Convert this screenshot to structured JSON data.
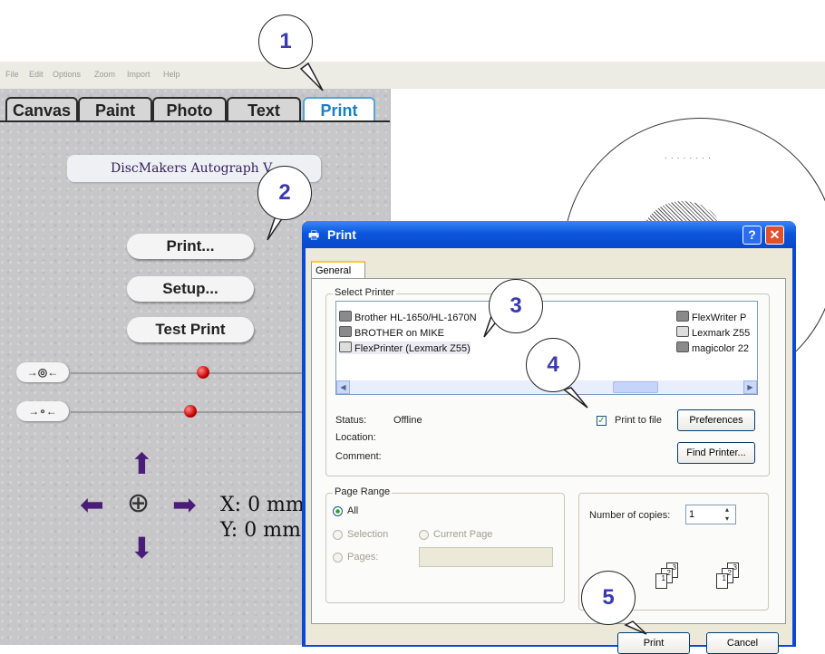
{
  "menu": [
    "File",
    "Edit",
    "Options",
    "Zoom",
    "Import",
    "Help"
  ],
  "tabs": [
    {
      "label": "Canvas",
      "active": false
    },
    {
      "label": "Paint",
      "active": false
    },
    {
      "label": "Photo",
      "active": false
    },
    {
      "label": "Text",
      "active": false
    },
    {
      "label": "Print",
      "active": true
    }
  ],
  "brand": "DiscMakers Autograph V",
  "buttons": {
    "print": "Print...",
    "setup": "Setup...",
    "test_print": "Test Print"
  },
  "coords": {
    "x": "X: 0 mm",
    "y": "Y: 0 mm"
  },
  "disc_text": "· · · · · · · ·",
  "dialog": {
    "title": "Print",
    "tab": "General",
    "select_printer_label": "Select Printer",
    "printers": [
      "Brother HL-1650/HL-1670N",
      "BROTHER on MIKE",
      "FlexPrinter (Lexmark Z55)",
      "FlexWriter P",
      "Lexmark Z55",
      "magicolor 22"
    ],
    "status_label": "Status:",
    "status_value": "Offline",
    "location_label": "Location:",
    "comment_label": "Comment:",
    "print_to_file": "Print to file",
    "preferences": "Preferences",
    "find_printer": "Find Printer...",
    "page_range_label": "Page Range",
    "all": "All",
    "selection": "Selection",
    "current_page": "Current Page",
    "pages": "Pages:",
    "copies_label": "Number of copies:",
    "copies_value": "1",
    "print_button": "Print",
    "cancel_button": "Cancel"
  },
  "callouts": [
    "1",
    "2",
    "3",
    "4",
    "5"
  ],
  "colors": {
    "title_blue": "#0b56dc",
    "tab_active": "#1a7ec4",
    "callout_text": "#3a3ab0",
    "arrow": "#4a1e77"
  }
}
